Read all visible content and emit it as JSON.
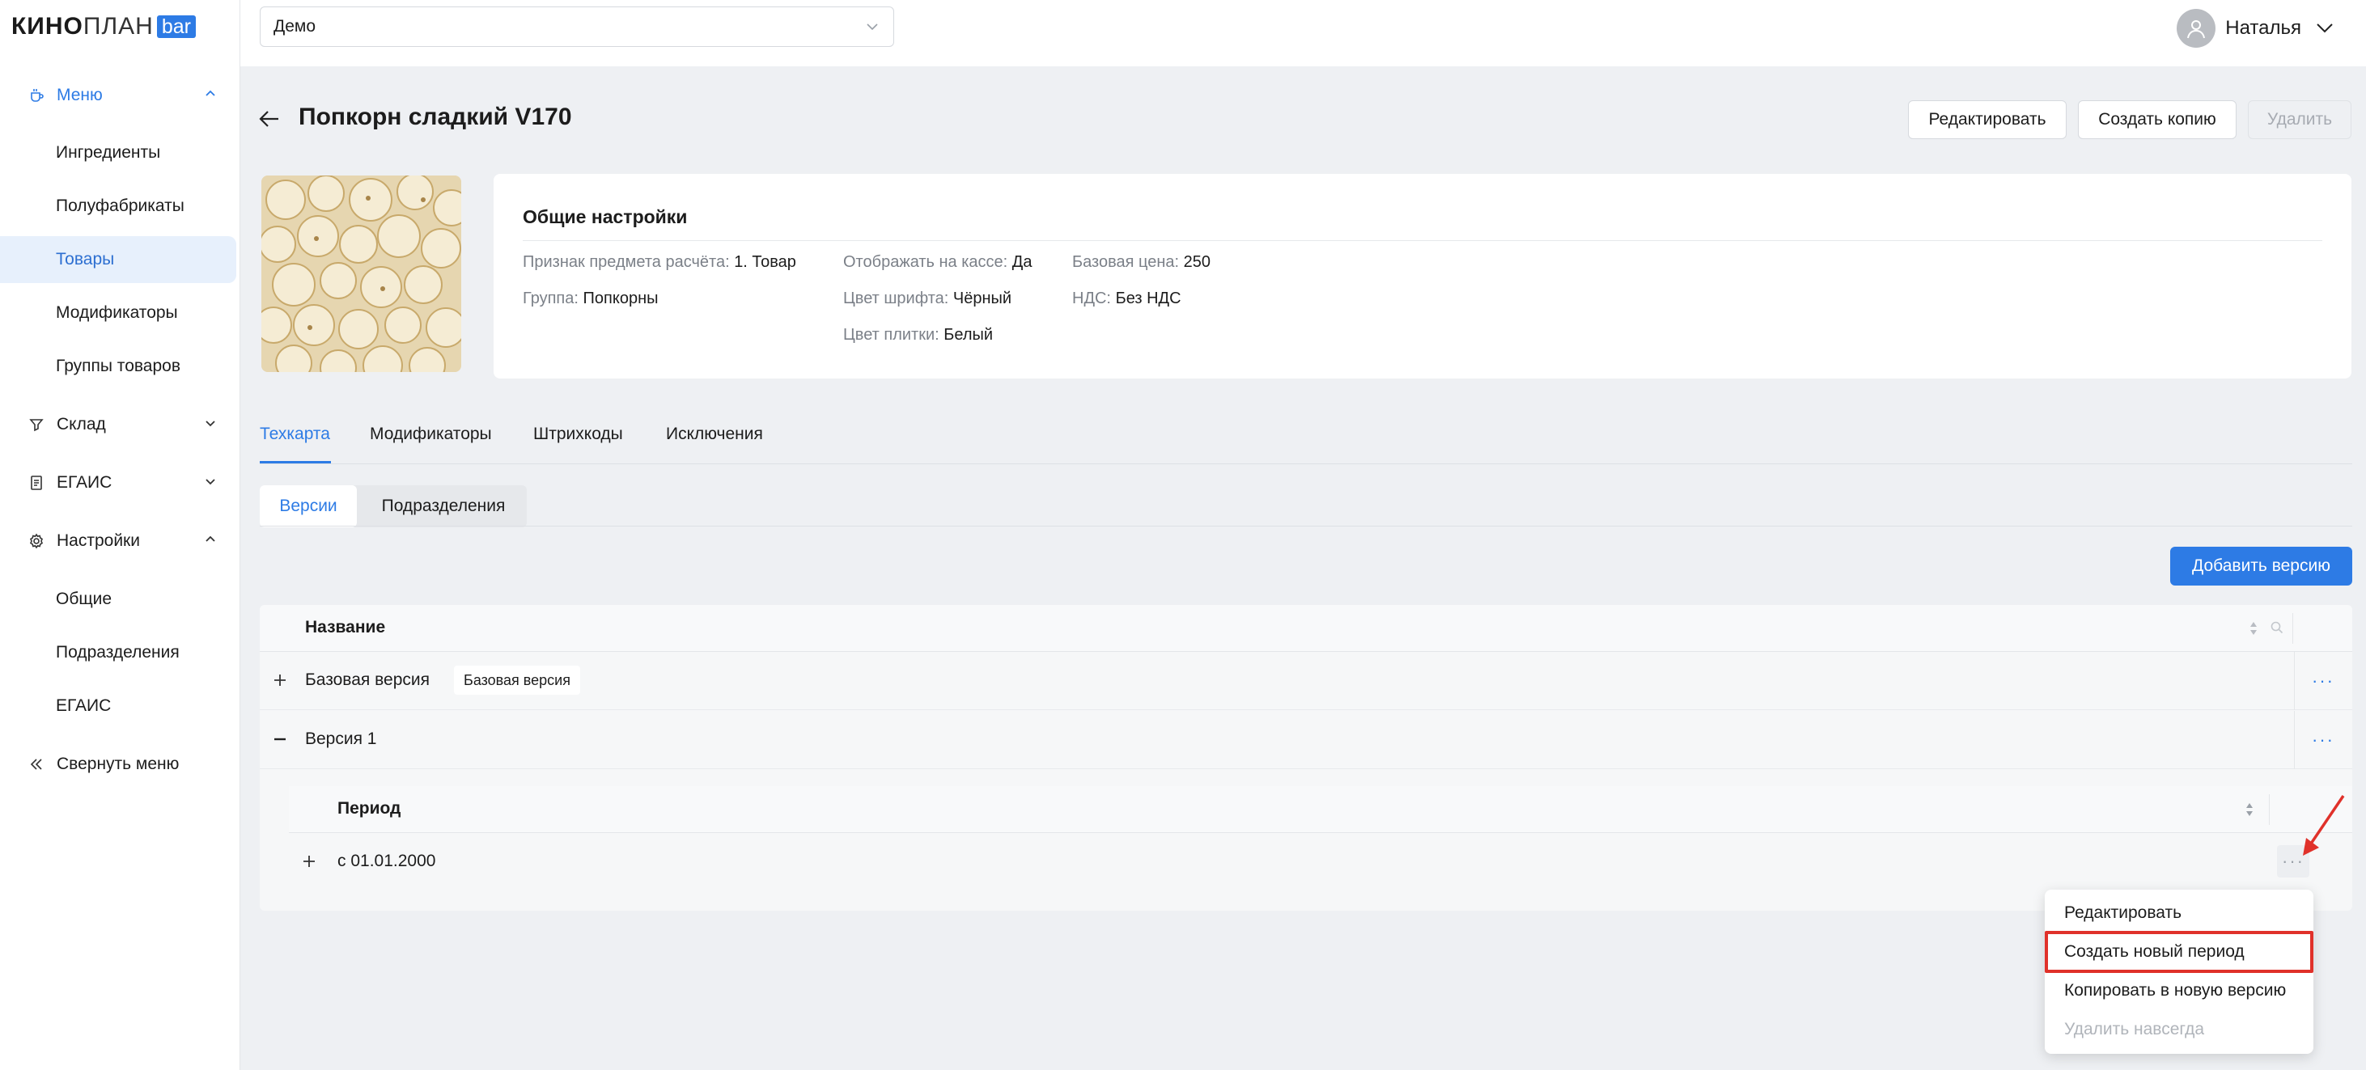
{
  "logo": {
    "bold": "КИНО",
    "light": "ПЛАН",
    "badge": "bar"
  },
  "sidebar": {
    "menu": {
      "label": "Меню",
      "items": [
        "Ингредиенты",
        "Полуфабрикаты",
        "Товары",
        "Модификаторы",
        "Группы товаров"
      ]
    },
    "warehouse": {
      "label": "Склад"
    },
    "egais": {
      "label": "ЕГАИС"
    },
    "settings": {
      "label": "Настройки",
      "items": [
        "Общие",
        "Подразделения",
        "ЕГАИС"
      ]
    },
    "collapse": "Свернуть меню"
  },
  "topbar": {
    "cinema": "Демо",
    "user": "Наталья"
  },
  "header": {
    "title": "Попкорн сладкий V170",
    "edit": "Редактировать",
    "copy": "Создать копию",
    "delete": "Удалить"
  },
  "general": {
    "title": "Общие настройки",
    "props": [
      {
        "k": "Признак предмета расчёта:",
        "v": "1. Товар"
      },
      {
        "k": "Группа:",
        "v": "Попкорны"
      },
      {
        "k": "Отображать на кассе:",
        "v": "Да"
      },
      {
        "k": "Цвет шрифта:",
        "v": "Чёрный"
      },
      {
        "k": "Цвет плитки:",
        "v": "Белый"
      },
      {
        "k": "Базовая цена:",
        "v": "250"
      },
      {
        "k": "НДС:",
        "v": "Без НДС"
      }
    ]
  },
  "tabs": [
    "Техкарта",
    "Модификаторы",
    "Штрихкоды",
    "Исключения"
  ],
  "subtabs": [
    "Версии",
    "Подразделения"
  ],
  "add_version": "Добавить версию",
  "table": {
    "column": "Название",
    "rows": [
      {
        "name": "Базовая версия",
        "tag": "Базовая версия"
      },
      {
        "name": "Версия 1"
      }
    ],
    "nested": {
      "column": "Период",
      "rows": [
        {
          "name": "с 01.01.2000"
        }
      ]
    },
    "more": "···"
  },
  "menu": [
    "Редактировать",
    "Создать новый период",
    "Копировать в новую версию",
    "Удалить навсегда"
  ],
  "colors": {
    "accent": "#2d7be5",
    "highlight": "#e0312a"
  }
}
